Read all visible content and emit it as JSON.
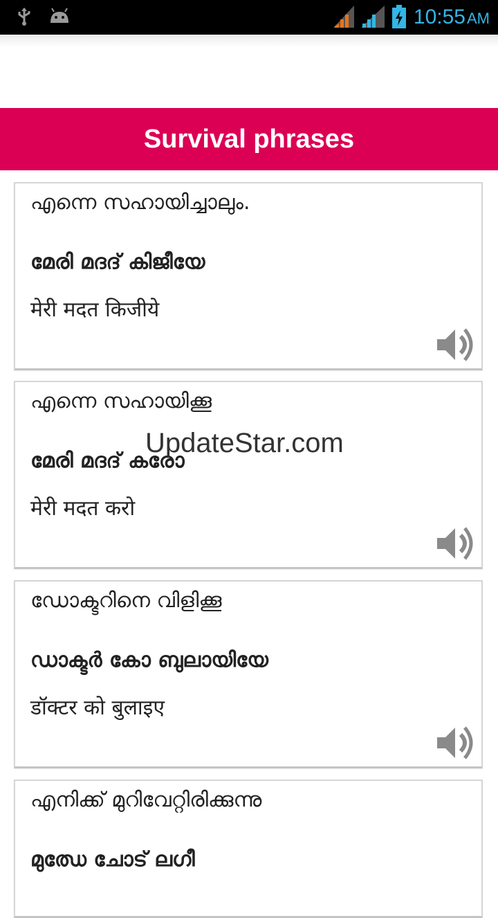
{
  "status_bar": {
    "time": "10:55",
    "ampm": "AM"
  },
  "header": {
    "title": "Survival phrases",
    "color": "#dc0055"
  },
  "phrases": [
    {
      "malayalam": "എന്നെ സഹായിച്ചാലും.",
      "transliteration": "മേരി മദദ് കിജീയേ",
      "hindi": "मेरी मदत किजीये"
    },
    {
      "malayalam": "എന്നെ സഹായിക്കൂ",
      "transliteration": "മേരി മദദ് കരോ",
      "hindi": "मेरी मदत करो"
    },
    {
      "malayalam": "ഡോക്ടറിനെ വിളിക്കൂ",
      "transliteration": "ഡാക്ടർ കോ ബുലായിയേ",
      "hindi": "डॉक्टर को बुलाइए"
    },
    {
      "malayalam": "എനിക്ക് മുറിവേറ്റിരിക്കുന്നു",
      "transliteration": "മുഝേ ചോട് ലഗീ",
      "hindi": ""
    }
  ],
  "watermark": "UpdateStar.com",
  "icons": {
    "speaker": "speaker-icon",
    "usb": "usb-icon",
    "android": "android-icon",
    "signal": "signal-icon",
    "battery": "battery-icon"
  }
}
